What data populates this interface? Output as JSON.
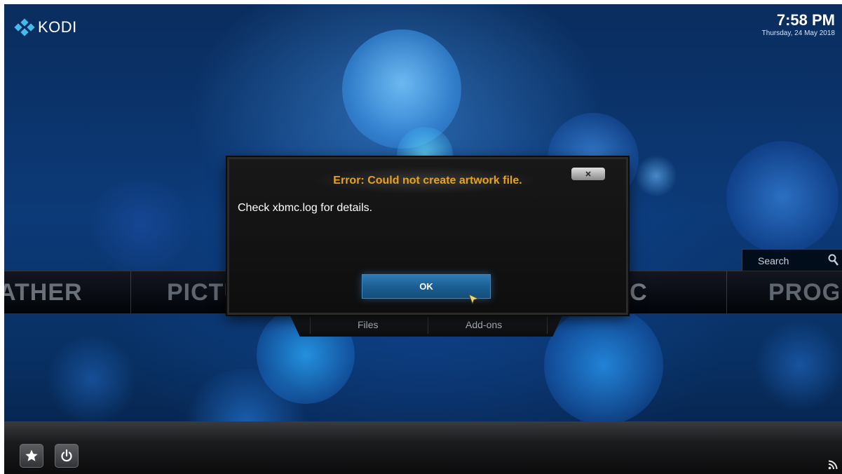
{
  "header": {
    "app_name": "KODI",
    "time": "7:58 PM",
    "date": "Thursday, 24 May 2018"
  },
  "main_menu": {
    "items": [
      "ATHER",
      "PICTU",
      "SIC",
      "PROGRA"
    ]
  },
  "submenu": {
    "items": [
      "Files",
      "Add-ons"
    ]
  },
  "search": {
    "label": "Search"
  },
  "dialog": {
    "title": "Error: Could not create artwork file.",
    "message": "Check xbmc.log for details.",
    "ok_label": "OK"
  },
  "colors": {
    "dialog_title": "#e8a21a",
    "ok_button": "#1b5f94",
    "logo_accent": "#48b8e8"
  },
  "icons": [
    "kodi-logo-icon",
    "search-icon",
    "favourites-star-icon",
    "power-icon",
    "rss-icon",
    "close-icon",
    "mouse-cursor-icon"
  ]
}
